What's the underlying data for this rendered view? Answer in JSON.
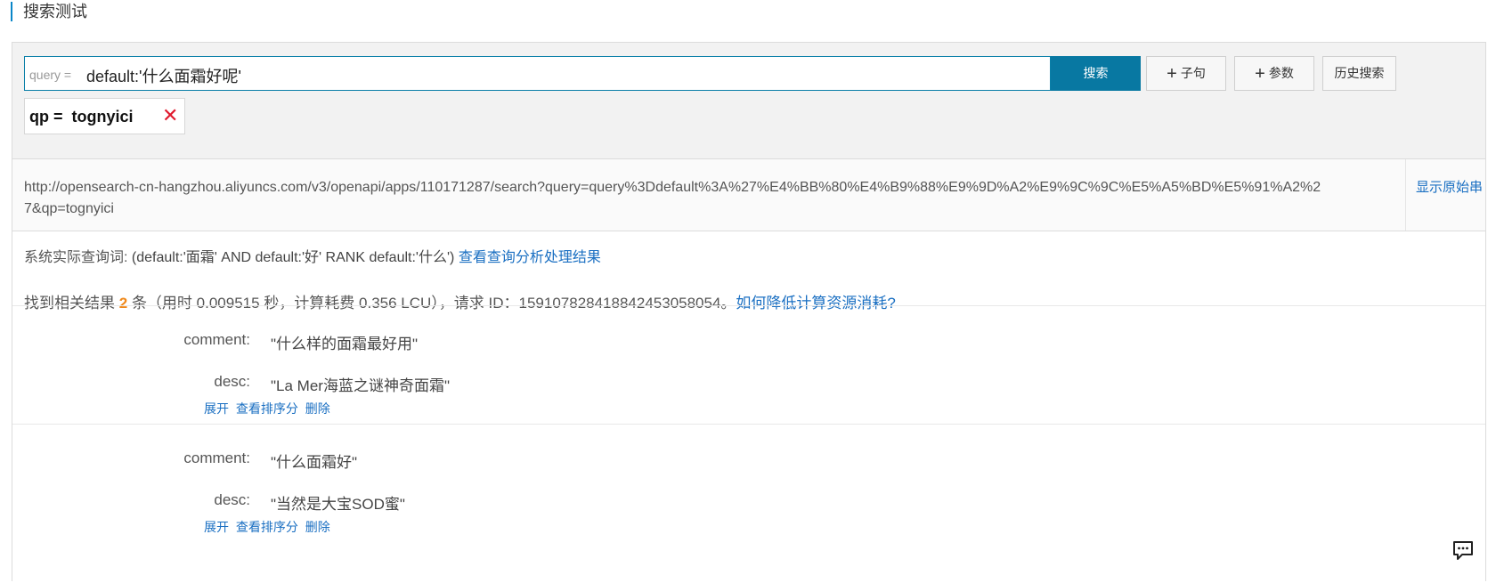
{
  "page": {
    "title": "搜索测试"
  },
  "search": {
    "query_prefix": "query =",
    "query_value": "default:'什么面霜好呢'",
    "search_button": "搜索",
    "add_clause_button": "子句",
    "add_param_button": "参数",
    "history_button": "历史搜索",
    "param_tag": "qp =  tognyici",
    "param_remove": "✕"
  },
  "request_url": {
    "url": "http://opensearch-cn-hangzhou.aliyuncs.com/v3/openapi/apps/110171287/search?query=query%3Ddefault%3A%27%E4%BB%80%E4%B9%88%E9%9D%A2%E9%9C%9C%E5%A5%BD%E5%91%A2%27&qp=tognyici",
    "show_raw_link": "显示原始串"
  },
  "actual_query": {
    "label": "系统实际查询词:",
    "expression": "(default:'面霜' AND default:'好' RANK default:'什么')",
    "analysis_link": "查看查询分析处理结果"
  },
  "summary": {
    "prefix": "找到相关结果",
    "count": "2",
    "suffix": "条（用时 0.009515 秒，计算耗费 0.356 LCU），请求 ID：159107828418842453058054。",
    "help_link": "如何降低计算资源消耗?"
  },
  "results": [
    {
      "comment_label": "comment:",
      "comment_value": "\"什么样的面霜最好用\"",
      "desc_label": "desc:",
      "desc_value": "\"La Mer海蓝之谜神奇面霜\"",
      "actions": [
        "展开",
        "查看排序分",
        "删除"
      ]
    },
    {
      "comment_label": "comment:",
      "comment_value": "\"什么面霜好\"",
      "desc_label": "desc:",
      "desc_value": "\"当然是大宝SOD蜜\"",
      "actions": [
        "展开",
        "查看排序分",
        "删除"
      ]
    }
  ],
  "icons": {
    "chat": "chat-bubble-icon"
  },
  "colors": {
    "primary": "#0878a2",
    "link": "#1a6fc2",
    "count": "#f0891b",
    "remove": "#e0192d"
  }
}
